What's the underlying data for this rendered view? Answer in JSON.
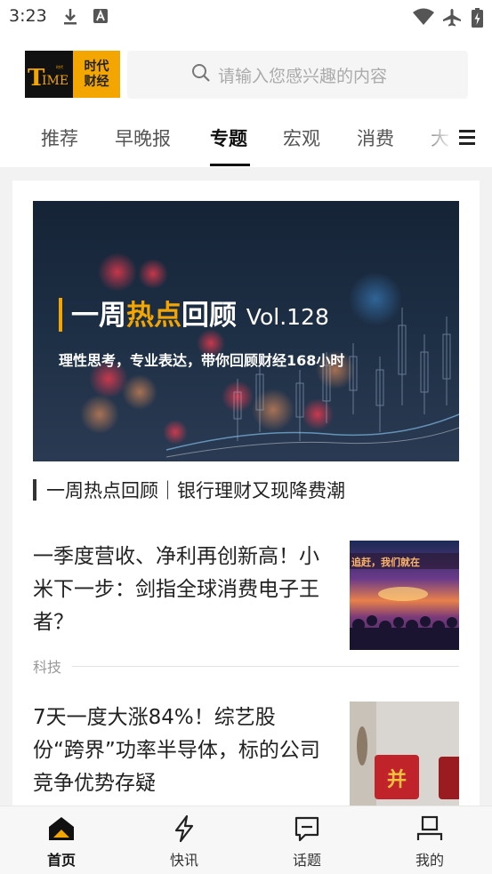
{
  "status_bar": {
    "time": "3:23",
    "left_icons": [
      "download-icon",
      "app-notification-icon"
    ],
    "right_icons": [
      "wifi-icon",
      "airplane-icon",
      "battery-icon"
    ]
  },
  "header": {
    "logo": {
      "latin": "TIME",
      "chinese_line1": "时代",
      "chinese_line2": "财经"
    },
    "search": {
      "placeholder": "请输入您感兴趣的内容"
    }
  },
  "tabs": {
    "items": [
      {
        "label": "推荐",
        "active": false
      },
      {
        "label": "早晚报",
        "active": false
      },
      {
        "label": "专题",
        "active": true
      },
      {
        "label": "宏观",
        "active": false
      },
      {
        "label": "消费",
        "active": false
      },
      {
        "label": "大",
        "active": false
      }
    ]
  },
  "feature": {
    "banner": {
      "title_part1": "一周",
      "title_hot": "热点",
      "title_part2": "回顾",
      "title_vol": "Vol.128",
      "subtitle": "理性思考，专业表达，带你回顾财经168小时"
    },
    "title": "一周热点回顾｜银行理财又现降费潮"
  },
  "articles": [
    {
      "title": "一季度营收、净利再创新高！小米下一步：剑指全球消费电子王者？",
      "tag": "科技",
      "thumb_text": "追赶，我们就在"
    },
    {
      "title": "7天一度大涨84%！综艺股份“跨界”功率半导体，标的公司竞争优势存疑",
      "thumb_text": "并"
    }
  ],
  "bottom_nav": {
    "items": [
      {
        "label": "首页",
        "icon": "home-icon",
        "active": true
      },
      {
        "label": "快讯",
        "icon": "lightning-icon",
        "active": false
      },
      {
        "label": "话题",
        "icon": "topic-icon",
        "active": false
      },
      {
        "label": "我的",
        "icon": "profile-icon",
        "active": false
      }
    ]
  },
  "colors": {
    "brand": "#f3a500",
    "text": "#222222",
    "muted": "#999999",
    "background": "#f2f2f2"
  }
}
